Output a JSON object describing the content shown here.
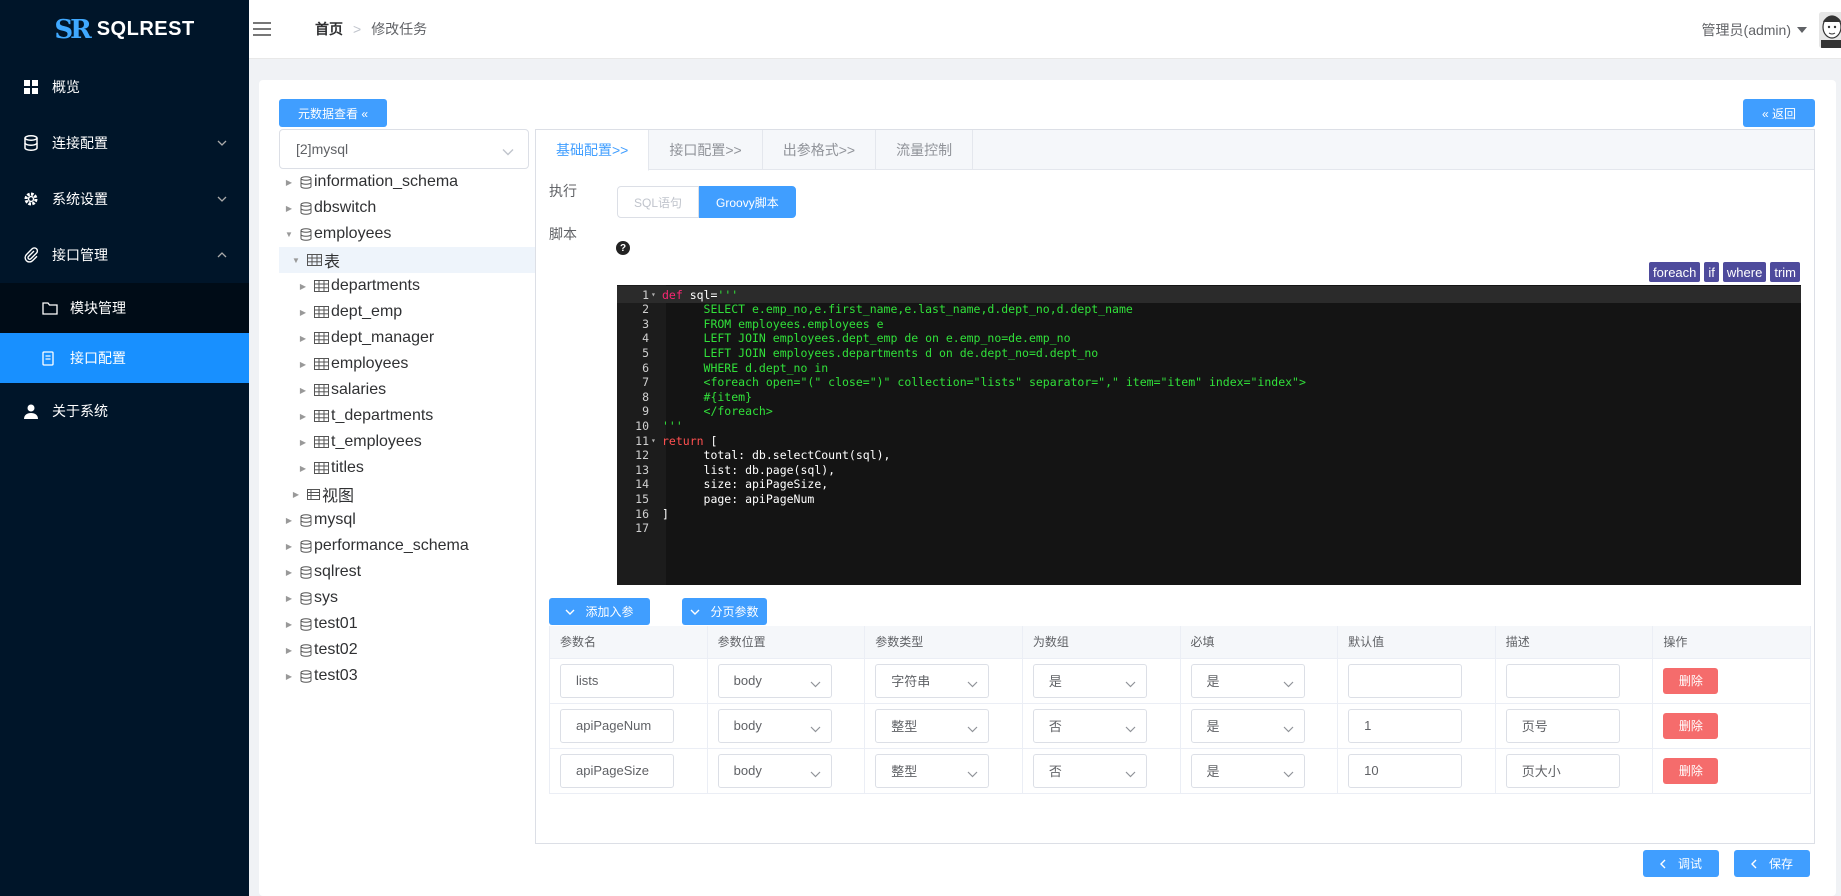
{
  "app": {
    "logo_mark": "SR",
    "logo_text": "SQLREST"
  },
  "sidebar": {
    "items": [
      {
        "label": "概览",
        "icon": "grid-icon"
      },
      {
        "label": "连接配置",
        "icon": "database-icon"
      },
      {
        "label": "系统设置",
        "icon": "gear-icon"
      },
      {
        "label": "接口管理",
        "icon": "paperclip-icon"
      },
      {
        "label": "关于系统",
        "icon": "user-icon"
      }
    ],
    "sub_items": [
      {
        "label": "模块管理",
        "icon": "folder-icon"
      },
      {
        "label": "接口配置",
        "icon": "document-icon"
      }
    ]
  },
  "header": {
    "breadcrumb_home": "首页",
    "breadcrumb_sep": ">",
    "breadcrumb_current": "修改任务",
    "user": "管理员(admin)"
  },
  "toolbar": {
    "meta_label": "元数据查看 «",
    "back_label": "« 返回"
  },
  "db_select": {
    "value": "[2]mysql"
  },
  "tree": [
    {
      "label": "information_schema",
      "type": "db",
      "level": 0,
      "toggle": "▶"
    },
    {
      "label": "dbswitch",
      "type": "db",
      "level": 0,
      "toggle": "▶"
    },
    {
      "label": "employees",
      "type": "db",
      "level": 0,
      "toggle": "▼"
    },
    {
      "label": "表",
      "type": "table",
      "level": 1,
      "toggle": "▼"
    },
    {
      "label": "departments",
      "type": "table",
      "level": 2,
      "toggle": "▶"
    },
    {
      "label": "dept_emp",
      "type": "table",
      "level": 2,
      "toggle": "▶"
    },
    {
      "label": "dept_manager",
      "type": "table",
      "level": 2,
      "toggle": "▶"
    },
    {
      "label": "employees",
      "type": "table",
      "level": 2,
      "toggle": "▶"
    },
    {
      "label": "salaries",
      "type": "table",
      "level": 2,
      "toggle": "▶"
    },
    {
      "label": "t_departments",
      "type": "table",
      "level": 2,
      "toggle": "▶"
    },
    {
      "label": "t_employees",
      "type": "table",
      "level": 2,
      "toggle": "▶"
    },
    {
      "label": "titles",
      "type": "table",
      "level": 2,
      "toggle": "▶"
    },
    {
      "label": "视图",
      "type": "view",
      "level": 1,
      "toggle": "▶"
    },
    {
      "label": "mysql",
      "type": "db",
      "level": 0,
      "toggle": "▶"
    },
    {
      "label": "performance_schema",
      "type": "db",
      "level": 0,
      "toggle": "▶"
    },
    {
      "label": "sqlrest",
      "type": "db",
      "level": 0,
      "toggle": "▶"
    },
    {
      "label": "sys",
      "type": "db",
      "level": 0,
      "toggle": "▶"
    },
    {
      "label": "test01",
      "type": "db",
      "level": 0,
      "toggle": "▶"
    },
    {
      "label": "test02",
      "type": "db",
      "level": 0,
      "toggle": "▶"
    },
    {
      "label": "test03",
      "type": "db",
      "level": 0,
      "toggle": "▶"
    }
  ],
  "tabs": [
    "基础配置>>",
    "接口配置>>",
    "出参格式>>",
    "流量控制"
  ],
  "form": {
    "exec_label": "执行",
    "seg_sql": "SQL语句",
    "seg_groovy": "Groovy脚本",
    "script_label": "脚本",
    "help": "?"
  },
  "snippets": [
    "foreach",
    "if",
    "where",
    "trim"
  ],
  "code": [
    [
      [
        "c-kw",
        "def"
      ],
      [
        "c-id",
        " sql="
      ],
      [
        "c-str",
        "'''"
      ]
    ],
    [
      [
        "c-str",
        "      SELECT e.emp_no,e.first_name,e.last_name,d.dept_no,d.dept_name"
      ]
    ],
    [
      [
        "c-str",
        "      FROM employees.employees e"
      ]
    ],
    [
      [
        "c-str",
        "      LEFT JOIN employees.dept_emp de on e.emp_no=de.emp_no"
      ]
    ],
    [
      [
        "c-str",
        "      LEFT JOIN employees.departments d on de.dept_no=d.dept_no"
      ]
    ],
    [
      [
        "c-str",
        "      WHERE d.dept_no in"
      ]
    ],
    [
      [
        "c-str",
        "      <foreach open=\"(\" close=\")\" collection=\"lists\" separator=\",\" item=\"item\" index=\"index\">"
      ]
    ],
    [
      [
        "c-str",
        "      #{item}"
      ]
    ],
    [
      [
        "c-str",
        "      </foreach>"
      ]
    ],
    [
      [
        "c-str",
        "'''"
      ]
    ],
    [
      [
        "c-kw2",
        "return"
      ],
      [
        "c-id",
        " ["
      ]
    ],
    [
      [
        "c-id",
        "      total: db.selectCount(sql),"
      ]
    ],
    [
      [
        "c-id",
        "      list: db.page(sql),"
      ]
    ],
    [
      [
        "c-id",
        "      size: apiPageSize,"
      ]
    ],
    [
      [
        "c-id",
        "      page: apiPageNum"
      ]
    ],
    [
      [
        "c-id",
        "]"
      ]
    ],
    []
  ],
  "fold_lines": [
    1,
    11
  ],
  "params": {
    "add_label": "添加入参",
    "page_label": "分页参数",
    "headers": [
      "参数名",
      "参数位置",
      "参数类型",
      "为数组",
      "必填",
      "默认值",
      "描述",
      "操作"
    ],
    "rows": [
      {
        "name": "lists",
        "location": "body",
        "type": "字符串",
        "is_array": "是",
        "required": "是",
        "default": "",
        "desc": "",
        "action": "删除"
      },
      {
        "name": "apiPageNum",
        "location": "body",
        "type": "整型",
        "is_array": "否",
        "required": "是",
        "default": "1",
        "desc": "页号",
        "action": "删除"
      },
      {
        "name": "apiPageSize",
        "location": "body",
        "type": "整型",
        "is_array": "否",
        "required": "是",
        "default": "10",
        "desc": "页大小",
        "action": "删除"
      }
    ]
  },
  "footer": {
    "debug_label": "调试",
    "save_label": "保存"
  },
  "colors": {
    "primary": "#409eff",
    "sidebar": "#001529",
    "danger": "#f56c6c",
    "snippet": "#4e4b9c"
  }
}
